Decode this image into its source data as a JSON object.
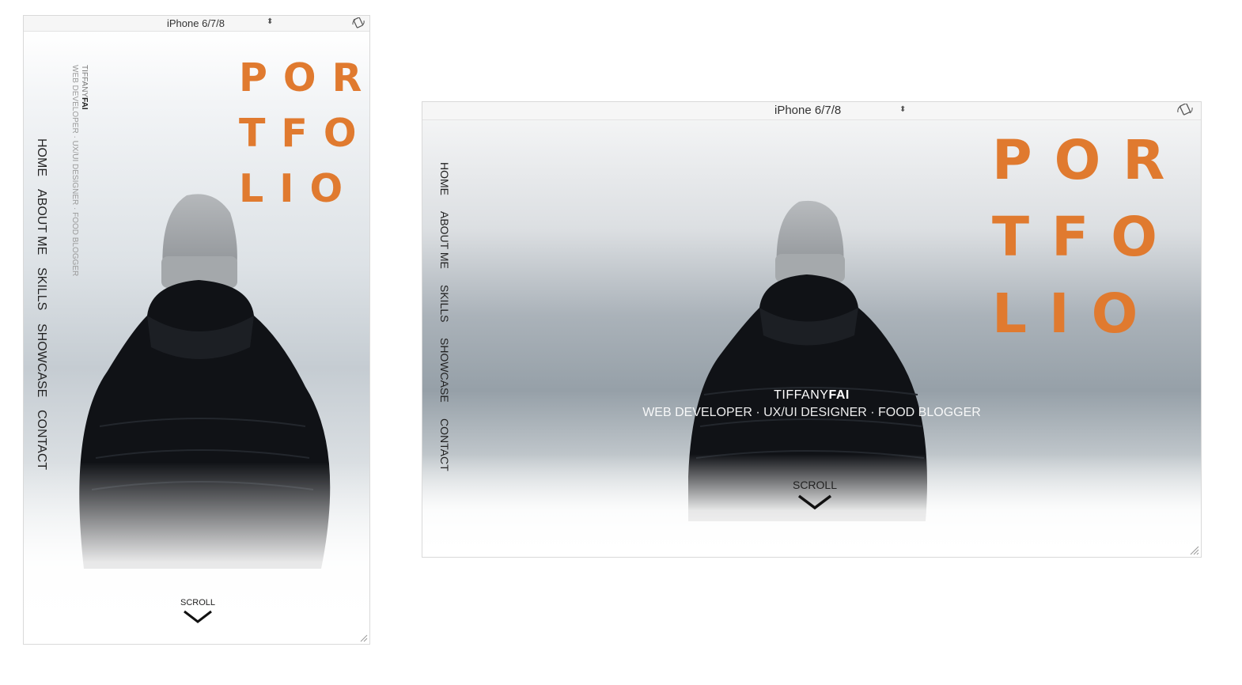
{
  "device": {
    "label": "iPhone 6/7/8",
    "updown_glyph": "⬍"
  },
  "site": {
    "title_lines": [
      "POR",
      "TFO",
      "LIO"
    ],
    "nav": [
      "HOME",
      "ABOUT ME",
      "SKILLS",
      "SHOWCASE",
      "CONTACT"
    ],
    "name_first": "TIFFANY",
    "name_last": "FAI",
    "role": "WEB DEVELOPER · UX/UI DESIGNER · FOOD BLOGGER",
    "scroll_label": "SCROLL"
  },
  "colors": {
    "accent": "#e07a2f",
    "nav_text": "#222222"
  },
  "icons": {
    "rotate": "rotate-device-icon",
    "chevron": "chevron-down-icon",
    "resize": "resize-handle-icon"
  }
}
